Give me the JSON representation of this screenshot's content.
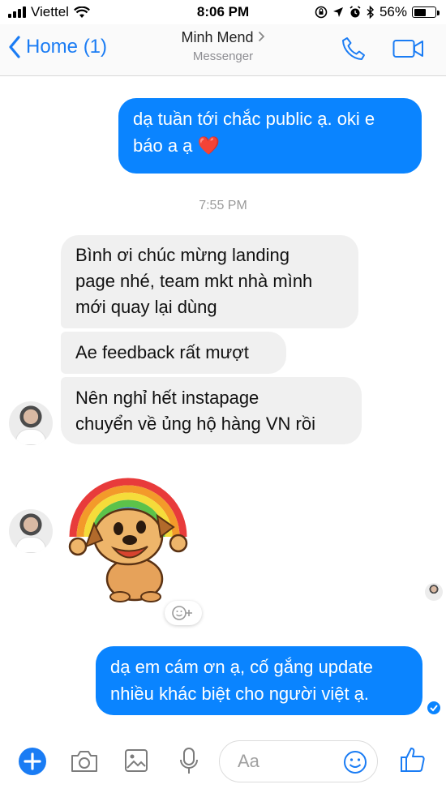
{
  "status": {
    "carrier": "Viettel",
    "time": "8:06 PM",
    "battery": "56%",
    "battery_level": 0.56
  },
  "nav": {
    "back_label": "Home (1)",
    "title": "Minh Mend",
    "subtitle": "Messenger"
  },
  "messages": {
    "out1_line1": "dạ tuần tới chắc public ạ. oki e",
    "out1_line2": "báo a ạ ❤️",
    "time": "7:55 PM",
    "in1_line1": "Bình ơi chúc mừng landing",
    "in1_line2": "page nhé, team mkt nhà mình",
    "in1_line3": "mới quay lại dùng",
    "in2": "Ae feedback rất mượt",
    "in3_line1": "Nên nghỉ hết instapage",
    "in3_line2": "chuyển về ủng hộ hàng VN rồi",
    "out2_line1": "dạ em cám ơn ạ, cố gắng update",
    "out2_line2": "nhiều khác biệt cho người việt ạ."
  },
  "composer": {
    "placeholder": "Aa"
  },
  "colors": {
    "accent": "#0a84ff",
    "incoming": "#f0f0f0"
  }
}
